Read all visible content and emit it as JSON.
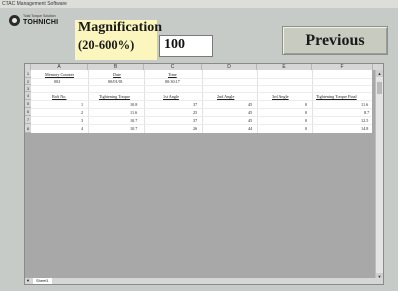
{
  "window": {
    "title": "CTAC Management Software"
  },
  "logo": {
    "small_text": "Total Torque Solution",
    "brand": "TOHNICHI"
  },
  "magnification": {
    "line1": "Magnification",
    "line2": "(20-600%)",
    "value": "100"
  },
  "previous_label": "Previous",
  "sheet": {
    "columns": [
      "A",
      "B",
      "C",
      "D",
      "E",
      "F"
    ],
    "rows": [
      "1",
      "2",
      "3",
      "4",
      "5",
      "6",
      "7",
      "8"
    ],
    "r1": {
      "a": "Memory Counter",
      "b": "Date",
      "c": "Time"
    },
    "r2": {
      "a": "002",
      "b": "00/01/01",
      "c": "00:30:17"
    },
    "r4": {
      "a": "Bolt No.",
      "b": "Tightening Torque",
      "c": "1st Angle",
      "d": "2nd Angle",
      "e": "3rd Angle",
      "f": "Tightening Torque Final"
    },
    "data": [
      [
        "1",
        "10.8",
        "37",
        "45",
        "0",
        "11.6"
      ],
      [
        "2",
        "11.6",
        "25",
        "45",
        "0",
        "8.7"
      ],
      [
        "3",
        "10.7",
        "37",
        "45",
        "0",
        "12.5"
      ],
      [
        "4",
        "10.7",
        "26",
        "44",
        "0",
        "14.8"
      ]
    ],
    "tab_label": "Sheet1",
    "tab_nav": "▼",
    "scroll_up": "▲",
    "scroll_down": "▼"
  }
}
